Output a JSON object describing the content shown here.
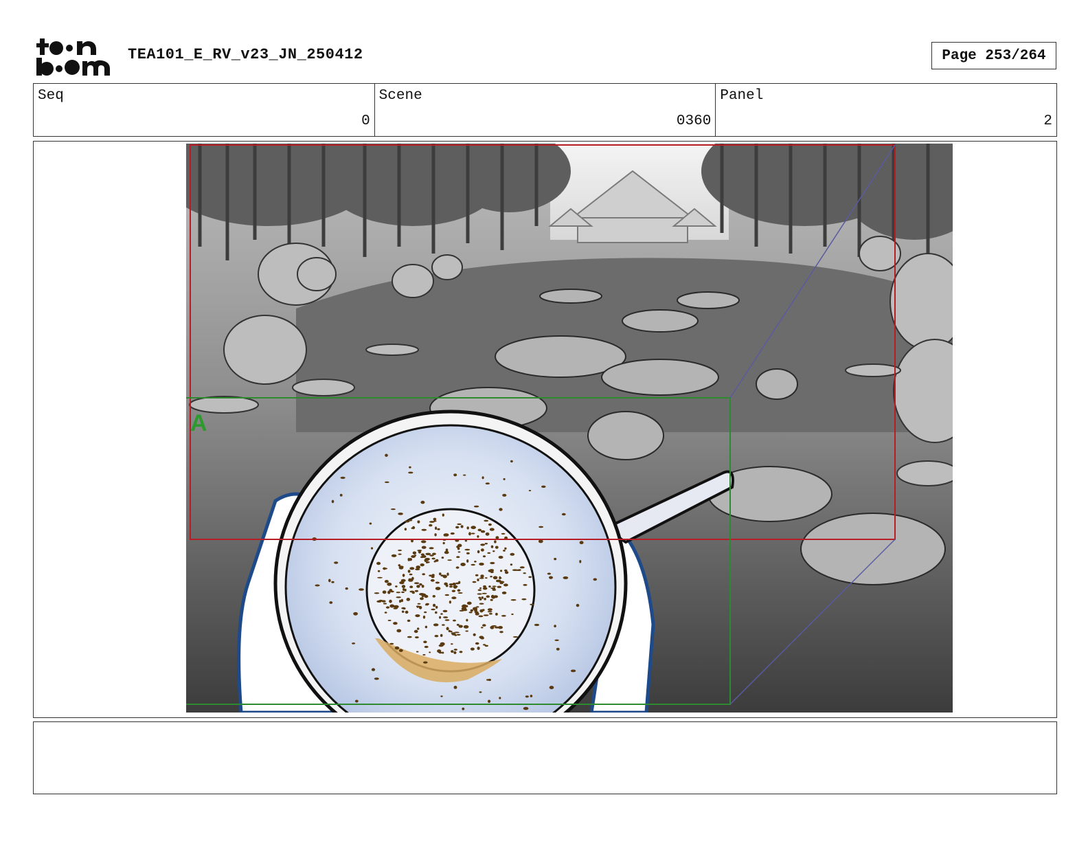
{
  "header": {
    "logo_text": "toon boom",
    "document_title": "TEA101_E_RV_v23_JN_250412",
    "page_label": "Page 253/264"
  },
  "info": {
    "seq_label": "Seq",
    "seq_value": "0",
    "scene_label": "Scene",
    "scene_value": "0360",
    "panel_label": "Panel",
    "panel_value": "2"
  },
  "panel": {
    "camera_label": "A"
  },
  "notes": {
    "text": ""
  },
  "colors": {
    "camera_frame_red": "#b81c24",
    "camera_frame_green": "#2e8a2e",
    "move_arrow": "#5a5aa0",
    "cup_rim": "#dfe7f5",
    "tea_leaves": "#5a3a10",
    "hand_outline": "#1f4a8a"
  }
}
